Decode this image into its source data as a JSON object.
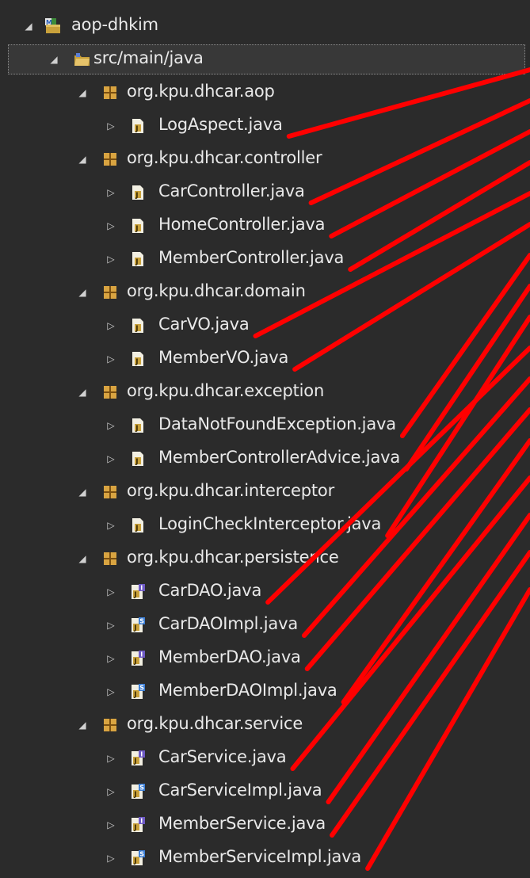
{
  "colors": {
    "background": "#2b2b2b",
    "text": "#e9e9e9",
    "package_icon": "#d9a441",
    "java_file_icon": "#c9a13b",
    "interface_icon": "#6f5bc6",
    "annotation_arrow": "#ff0000"
  },
  "tree": {
    "project": {
      "label": "aop-dhkim",
      "icon": "maven-spring-project-icon",
      "expanded": true
    },
    "source_folder": {
      "label": "src/main/java",
      "icon": "source-folder-icon",
      "expanded": true
    },
    "packages": [
      {
        "label": "org.kpu.dhcar.aop",
        "expanded": true,
        "files": [
          {
            "label": "LogAspect.java",
            "kind": "class"
          }
        ]
      },
      {
        "label": "org.kpu.dhcar.controller",
        "expanded": true,
        "files": [
          {
            "label": "CarController.java",
            "kind": "class"
          },
          {
            "label": "HomeController.java",
            "kind": "class"
          },
          {
            "label": "MemberController.java",
            "kind": "class"
          }
        ]
      },
      {
        "label": "org.kpu.dhcar.domain",
        "expanded": true,
        "files": [
          {
            "label": "CarVO.java",
            "kind": "class"
          },
          {
            "label": "MemberVO.java",
            "kind": "class"
          }
        ]
      },
      {
        "label": "org.kpu.dhcar.exception",
        "expanded": true,
        "files": [
          {
            "label": "DataNotFoundException.java",
            "kind": "class"
          },
          {
            "label": "MemberControllerAdvice.java",
            "kind": "class"
          }
        ]
      },
      {
        "label": "org.kpu.dhcar.interceptor",
        "expanded": true,
        "files": [
          {
            "label": "LoginCheckInterceptor.java",
            "kind": "class"
          }
        ]
      },
      {
        "label": "org.kpu.dhcar.persistence",
        "expanded": true,
        "files": [
          {
            "label": "CarDAO.java",
            "kind": "interface"
          },
          {
            "label": "CarDAOImpl.java",
            "kind": "spring-class"
          },
          {
            "label": "MemberDAO.java",
            "kind": "interface"
          },
          {
            "label": "MemberDAOImpl.java",
            "kind": "spring-class"
          }
        ]
      },
      {
        "label": "org.kpu.dhcar.service",
        "expanded": true,
        "files": [
          {
            "label": "CarService.java",
            "kind": "interface"
          },
          {
            "label": "CarServiceImpl.java",
            "kind": "spring-class"
          },
          {
            "label": "MemberService.java",
            "kind": "interface"
          },
          {
            "label": "MemberServiceImpl.java",
            "kind": "spring-class"
          }
        ]
      }
    ]
  }
}
